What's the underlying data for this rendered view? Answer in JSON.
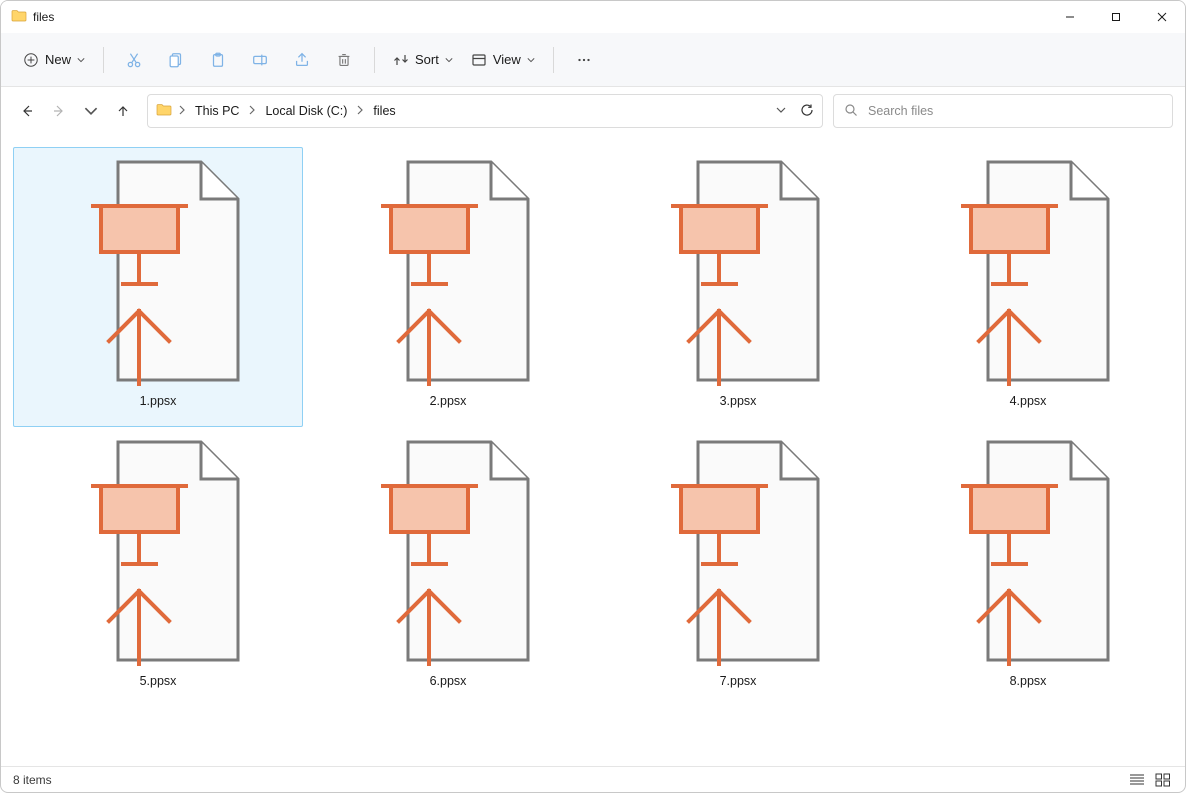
{
  "window": {
    "title": "files"
  },
  "toolbar": {
    "new_label": "New",
    "sort_label": "Sort",
    "view_label": "View"
  },
  "breadcrumbs": [
    "This PC",
    "Local Disk (C:)",
    "files"
  ],
  "search": {
    "placeholder": "Search files"
  },
  "files": [
    {
      "name": "1.ppsx",
      "selected": true
    },
    {
      "name": "2.ppsx",
      "selected": false
    },
    {
      "name": "3.ppsx",
      "selected": false
    },
    {
      "name": "4.ppsx",
      "selected": false
    },
    {
      "name": "5.ppsx",
      "selected": false
    },
    {
      "name": "6.ppsx",
      "selected": false
    },
    {
      "name": "7.ppsx",
      "selected": false
    },
    {
      "name": "8.ppsx",
      "selected": false
    }
  ],
  "status": {
    "text": "8 items"
  },
  "colors": {
    "accent_orange": "#e06a3b",
    "fill_orange": "#f6c4ac",
    "page_gray": "#7a7a7a",
    "page_fill": "#fafafa"
  }
}
